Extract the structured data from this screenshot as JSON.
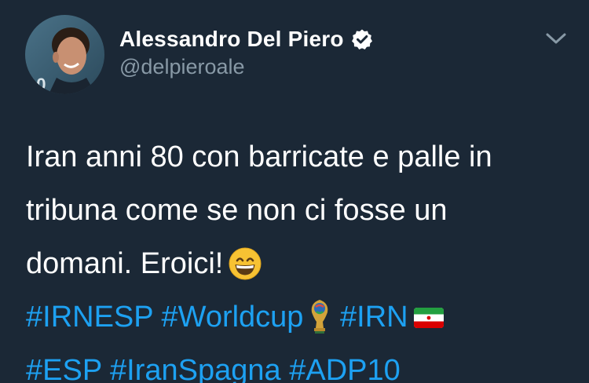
{
  "user": {
    "display_name": "Alessandro Del Piero",
    "handle": "@delpieroale",
    "avatar_icon": "profile-photo",
    "verified_icon": "verified-badge-icon"
  },
  "menu": {
    "icon": "chevron-down-icon"
  },
  "tweet": {
    "line1": "Iran anni 80 con barricate e palle in",
    "line2": "tribuna come se non ci fosse un",
    "line3": "domani. Eroici!",
    "line3_emoji": "grinning-face-icon",
    "hashtags_row1": [
      "#IRNESP",
      "#Worldcup",
      "#IRN"
    ],
    "hashtags_row2": [
      "#ESP",
      "#IranSpagna",
      "#ADP10"
    ],
    "worldcup_emoji": "world-cup-trophy-icon",
    "irn_emoji": "iran-flag-icon"
  },
  "colors": {
    "background": "#1b2836",
    "text": "#ffffff",
    "secondary": "#8899a6",
    "link": "#1da1f2"
  }
}
